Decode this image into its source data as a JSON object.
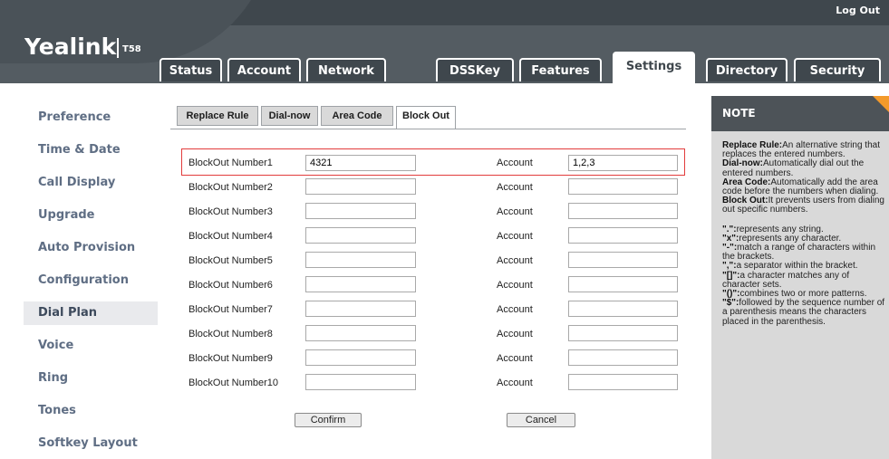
{
  "header": {
    "brand": "Yealink",
    "model": "T58",
    "logout_label": "Log Out",
    "tabs": [
      {
        "label": "Status"
      },
      {
        "label": "Account"
      },
      {
        "label": "Network"
      },
      {
        "label": "DSSKey"
      },
      {
        "label": "Features"
      },
      {
        "label": "Settings",
        "active": true
      },
      {
        "label": "Directory"
      },
      {
        "label": "Security"
      }
    ]
  },
  "sidebar": {
    "items": [
      {
        "label": "Preference"
      },
      {
        "label": "Time & Date"
      },
      {
        "label": "Call Display"
      },
      {
        "label": "Upgrade"
      },
      {
        "label": "Auto Provision"
      },
      {
        "label": "Configuration"
      },
      {
        "label": "Dial Plan",
        "active": true
      },
      {
        "label": "Voice"
      },
      {
        "label": "Ring"
      },
      {
        "label": "Tones"
      },
      {
        "label": "Softkey Layout"
      }
    ]
  },
  "subtabs": [
    {
      "label": "Replace Rule"
    },
    {
      "label": "Dial-now"
    },
    {
      "label": "Area Code"
    },
    {
      "label": "Block Out",
      "active": true
    }
  ],
  "blockout": {
    "account_label": "Account",
    "rows": [
      {
        "label": "BlockOut Number1",
        "number": "4321",
        "account": "1,2,3"
      },
      {
        "label": "BlockOut Number2",
        "number": "",
        "account": ""
      },
      {
        "label": "BlockOut Number3",
        "number": "",
        "account": ""
      },
      {
        "label": "BlockOut Number4",
        "number": "",
        "account": ""
      },
      {
        "label": "BlockOut Number5",
        "number": "",
        "account": ""
      },
      {
        "label": "BlockOut Number6",
        "number": "",
        "account": ""
      },
      {
        "label": "BlockOut Number7",
        "number": "",
        "account": ""
      },
      {
        "label": "BlockOut Number8",
        "number": "",
        "account": ""
      },
      {
        "label": "BlockOut Number9",
        "number": "",
        "account": ""
      },
      {
        "label": "BlockOut Number10",
        "number": "",
        "account": ""
      }
    ],
    "confirm_label": "Confirm",
    "cancel_label": "Cancel"
  },
  "note": {
    "title": "NOTE",
    "defs": [
      {
        "term": "Replace Rule:",
        "text": "An alternative string that replaces the entered numbers."
      },
      {
        "term": "Dial-now:",
        "text": "Automatically dial out the entered numbers."
      },
      {
        "term": "Area Code:",
        "text": "Automatically add the area code before the numbers when dialing."
      },
      {
        "term": "Block Out:",
        "text": "It prevents users from dialing out specific numbers."
      }
    ],
    "syms": [
      {
        "term": "\".\":",
        "text": "represents any string."
      },
      {
        "term": "\"x\":",
        "text": "represents any character."
      },
      {
        "term": "\"-\":",
        "text": "match a range of characters within the brackets."
      },
      {
        "term": "\",\":",
        "text": "a separator within the bracket."
      },
      {
        "term": "\"[]\":",
        "text": "a character matches any of character sets."
      },
      {
        "term": "\"()\":",
        "text": "combines two or more patterns."
      },
      {
        "term": "\"$\":",
        "text": "followed by the sequence number of a parenthesis means the characters placed in the parenthesis."
      }
    ]
  },
  "colors": {
    "header_dark": "#3f474d",
    "nav_text": "#5f6e84",
    "highlight_red": "#e23c3c",
    "note_accent": "#f39a2b"
  }
}
